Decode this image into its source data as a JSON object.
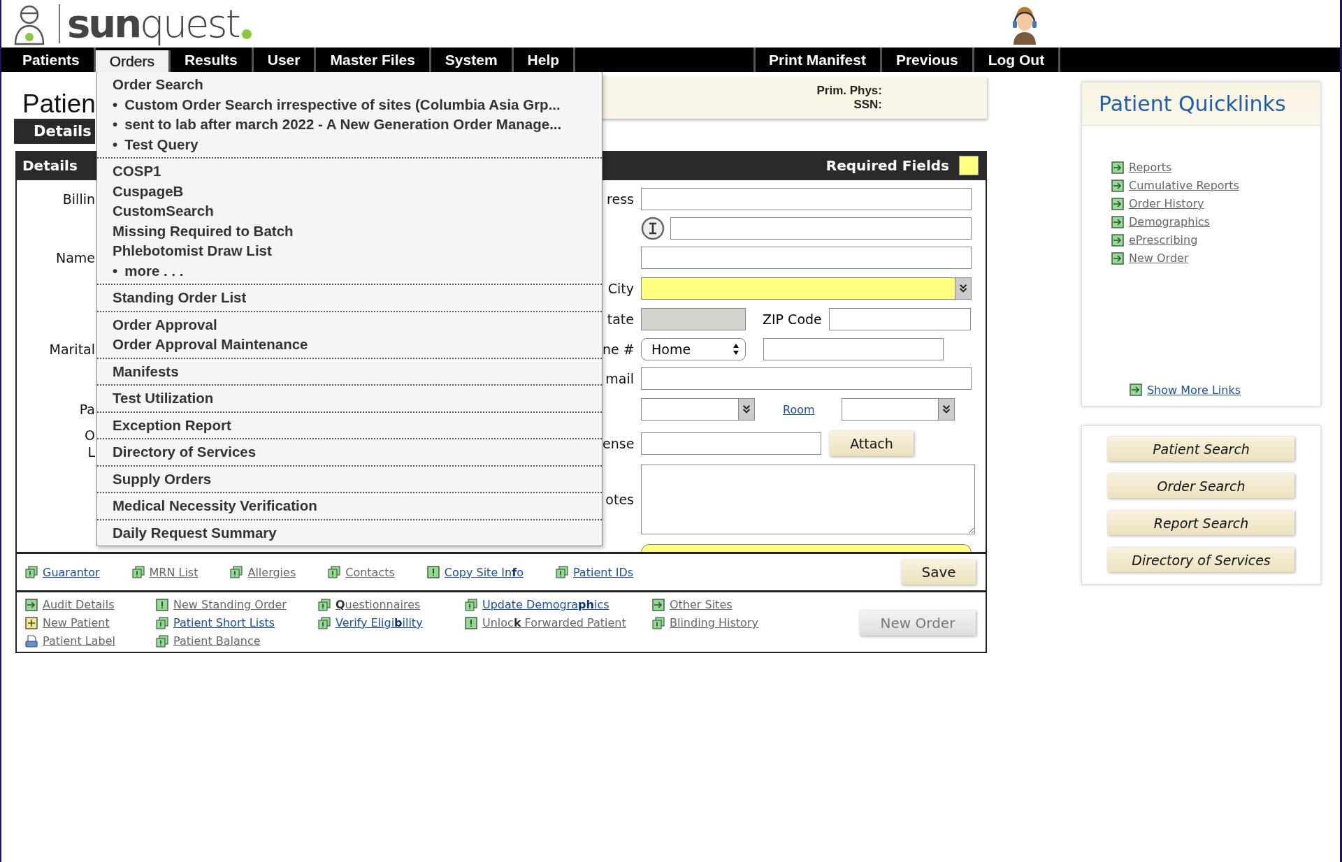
{
  "header": {
    "logo_text": "**sun**quest"
  },
  "nav": {
    "left": [
      {
        "label": "Patients",
        "selected": false
      },
      {
        "label": "Orders",
        "selected": true
      },
      {
        "label": "Results",
        "selected": false
      },
      {
        "label": "User",
        "selected": false
      },
      {
        "label": "Master Files",
        "selected": false
      },
      {
        "label": "System",
        "selected": false
      },
      {
        "label": "Help",
        "selected": false
      }
    ],
    "right": [
      {
        "label": "Print Manifest",
        "selected": false
      },
      {
        "label": "Previous",
        "selected": false
      },
      {
        "label": "Log Out",
        "selected": false
      }
    ]
  },
  "orders_menu": {
    "groups": [
      [
        {
          "label": "Order Search"
        },
        {
          "bullet": "•",
          "label": "Custom Order Search irrespective of sites (Columbia Asia Grp..."
        },
        {
          "bullet": "•",
          "label": "sent to lab after march 2022 - A New Generation Order Manage..."
        },
        {
          "bullet": "•",
          "label": "Test Query"
        }
      ],
      [
        {
          "label": "COSP1"
        },
        {
          "label": "CuspageB"
        },
        {
          "label": "CustomSearch"
        },
        {
          "label": "Missing Required to Batch"
        },
        {
          "label": "Phlebotomist Draw List"
        },
        {
          "bullet": "•",
          "label": "more . . ."
        }
      ],
      [
        {
          "label": "Standing Order List"
        }
      ],
      [
        {
          "label": "Order Approval"
        },
        {
          "label": "Order Approval Maintenance"
        }
      ],
      [
        {
          "label": "Manifests"
        }
      ],
      [
        {
          "label": "Test Utilization"
        }
      ],
      [
        {
          "label": "Exception Report"
        }
      ],
      [
        {
          "label": "Directory of Services"
        }
      ],
      [
        {
          "label": "Supply Orders"
        }
      ],
      [
        {
          "label": "Medical Necessity Verification"
        }
      ],
      [
        {
          "label": "Daily Request Summary"
        }
      ]
    ]
  },
  "page_title": "Patien",
  "patient_info": {
    "lines": [
      "Prim. Phys:",
      "SSN:"
    ]
  },
  "details": {
    "tab": "Details",
    "bar_title": "Details",
    "required_label": "Required Fields"
  },
  "form_rows": [
    {
      "kind": "text",
      "left_labels": [
        "Billin"
      ],
      "right_label": "ress",
      "required": false
    },
    {
      "kind": "info_text"
    },
    {
      "kind": "text",
      "left_labels": [
        "Name"
      ],
      "required": false
    },
    {
      "kind": "select",
      "right_label": "City",
      "required": true
    },
    {
      "kind": "state_zip",
      "right_label": "tate",
      "state_disabled": true,
      "zip_label": "ZIP Code"
    },
    {
      "kind": "phone",
      "left_labels": [
        "Marital"
      ],
      "right_label": "ne #",
      "value": "Home"
    },
    {
      "kind": "text",
      "right_label": "mail",
      "required": false
    },
    {
      "kind": "location",
      "left_labels": [
        "Pa"
      ],
      "room_link": "Room"
    },
    {
      "kind": "license",
      "left_labels": [
        "O",
        "L"
      ],
      "right_label": "ense",
      "button": "Attach"
    },
    {
      "kind": "notes",
      "right_label": "otes"
    },
    {
      "kind": "partial",
      "required": true
    }
  ],
  "link_bar": {
    "links": [
      {
        "label": "Guarantor",
        "kind": "alert",
        "enabled": true
      },
      {
        "label": "MRN List",
        "kind": "alert",
        "enabled": false
      },
      {
        "label": "Allergies",
        "kind": "alert",
        "enabled": false
      },
      {
        "label": "Contacts",
        "kind": "alert",
        "enabled": false
      },
      {
        "label": "Copy Site In**f**o",
        "kind": "warn",
        "enabled": true
      },
      {
        "label": "Patient IDs",
        "kind": "alert",
        "enabled": true
      }
    ],
    "save_button": "Save"
  },
  "more_links": {
    "rows": [
      [
        {
          "label": "Audit Details",
          "kind": "arrow",
          "enabled": false
        },
        {
          "label": "New Standing Order",
          "kind": "warn",
          "enabled": false
        },
        {
          "label": "**Q**uestionnaires",
          "kind": "alert",
          "enabled": false
        },
        {
          "label": "Update Demogra**ph**ics",
          "kind": "alert",
          "enabled": true
        },
        {
          "label": "Other Sites",
          "kind": "arrow",
          "enabled": false
        }
      ],
      [
        {
          "label": "New Patient",
          "kind": "add",
          "enabled": false
        },
        {
          "label": "Patient Short Lists",
          "kind": "alert",
          "enabled": true
        },
        {
          "label": "Verify Eligi**b**ility",
          "kind": "alert",
          "enabled": true
        },
        {
          "label": "Unloc**k** Forwarded Patient",
          "kind": "warn",
          "enabled": false
        },
        {
          "label": "Blinding History",
          "kind": "alert",
          "enabled": false
        }
      ],
      [
        {
          "label": "Patient Label",
          "kind": "print",
          "enabled": false
        },
        {
          "label": "Patient Balance",
          "kind": "alert",
          "enabled": false
        }
      ]
    ],
    "new_order_button": {
      "label": "New Order",
      "disabled": true
    }
  },
  "quicklinks": {
    "title": "Patient Quicklinks",
    "links": [
      {
        "label": "Reports",
        "enabled": false
      },
      {
        "label": "Cumulative Reports",
        "enabled": false
      },
      {
        "label": "Order History",
        "enabled": false
      },
      {
        "label": "Demographics",
        "enabled": false
      },
      {
        "label": "ePrescribing",
        "enabled": false
      },
      {
        "label": "New Order",
        "enabled": false
      }
    ],
    "show_more": {
      "label": "Show More Links",
      "enabled": true
    }
  },
  "search_buttons": [
    "Patient Search",
    "Order Search",
    "Report Search",
    "Directory of Services"
  ]
}
